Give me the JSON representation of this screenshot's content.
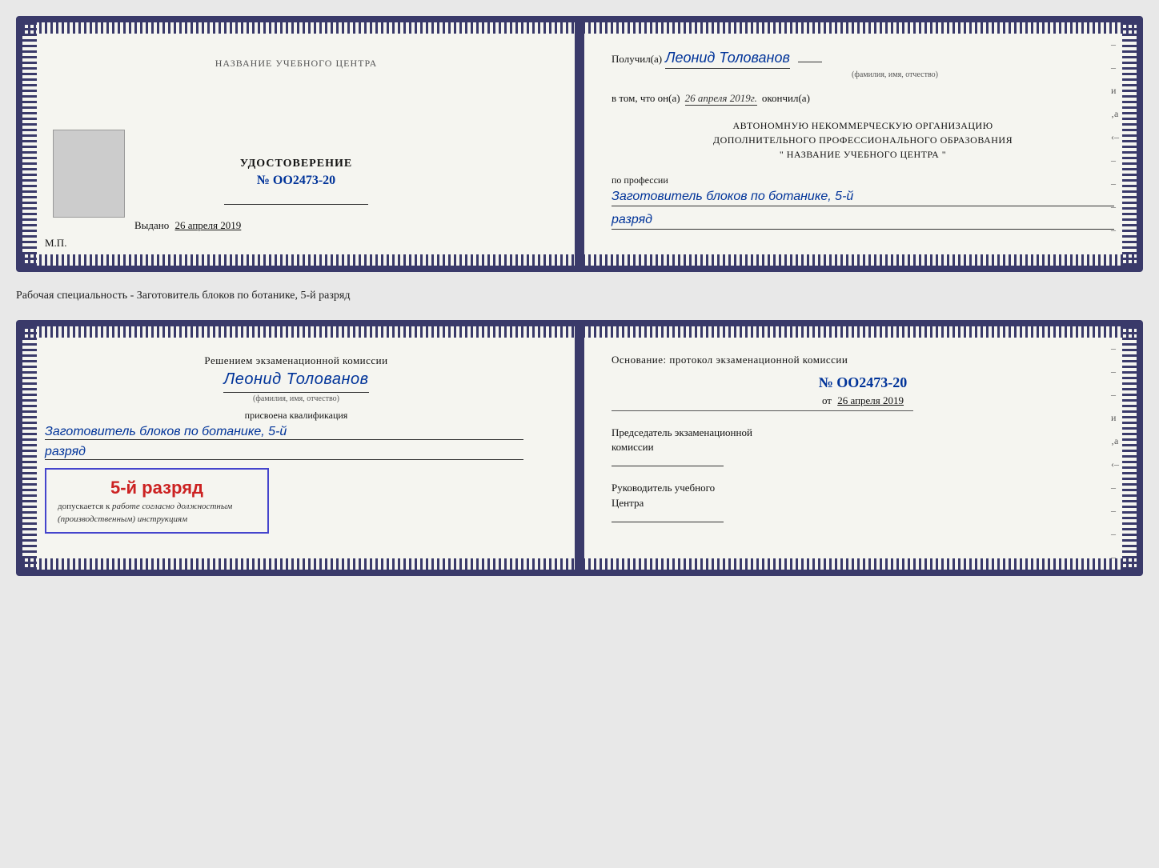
{
  "doc1": {
    "left": {
      "title": "УДОСТОВЕРЕНИЕ",
      "number": "№ OO2473-20",
      "vydano_label": "Выдано",
      "vydano_date": "26 апреля 2019",
      "mp_label": "М.П."
    },
    "right": {
      "poluchil_prefix": "Получил(а)",
      "poluchil_name": "Леонид Толованов",
      "fio_hint": "(фамилия, имя, отчество)",
      "vtom_prefix": "в том, что он(а)",
      "vtom_date": "26 апреля 2019г.",
      "okончил": "окончил(а)",
      "avtonom_line1": "АВТОНОМНУЮ НЕКОММЕРЧЕСКУЮ ОРГАНИЗАЦИЮ",
      "avtonom_line2": "ДОПОЛНИТЕЛЬНОГО ПРОФЕССИОНАЛЬНОГО ОБРАЗОВАНИЯ",
      "avtonom_line3": "\"  НАЗВАНИЕ УЧЕБНОГО ЦЕНТРА  \"",
      "po_professii": "по профессии",
      "professiya": "Заготовитель блоков по ботанике, 5-й",
      "razryad": "разряд",
      "nazvanie_title": "НАЗВАНИЕ УЧЕБНОГО ЦЕНТРА"
    }
  },
  "middle_label": "Рабочая специальность - Заготовитель блоков по ботанике, 5-й разряд",
  "doc2": {
    "left": {
      "resheniem": "Решением экзаменационной комиссии",
      "name": "Леонид Толованов",
      "fio_hint": "(фамилия, имя, отчество)",
      "prisvoena": "присвоена квалификация",
      "kval": "Заготовитель блоков по ботанике, 5-й",
      "razryad": "разряд",
      "stamp_main": "5-й разряд",
      "dopusk_prefix": "допускается к",
      "dopusk_italic": "работе согласно должностным",
      "dopusk_italic2": "(производственным) инструкциям"
    },
    "right": {
      "osnovanie": "Основание: протокол экзаменационной комиссии",
      "number": "№  OO2473-20",
      "ot_prefix": "от",
      "ot_date": "26 апреля 2019",
      "predsedatel_line1": "Председатель экзаменационной",
      "predsedatel_line2": "комиссии",
      "rukovoditel_line1": "Руководитель учебного",
      "rukovoditel_line2": "Центра"
    }
  }
}
